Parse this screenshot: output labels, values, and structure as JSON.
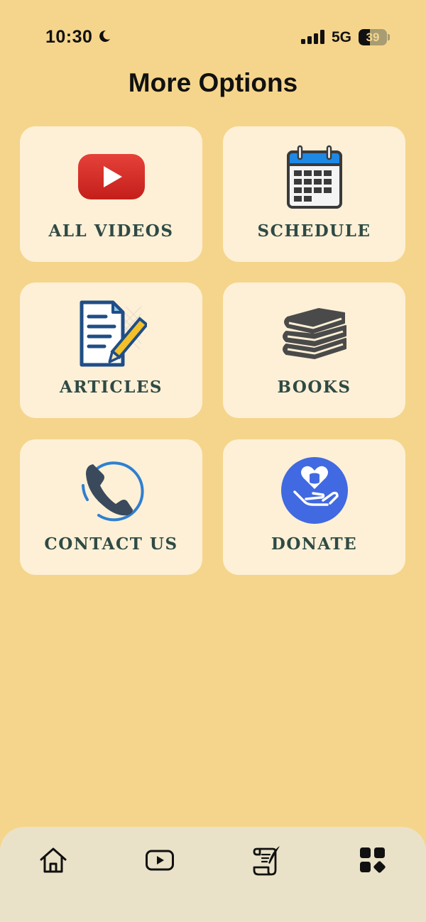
{
  "status_bar": {
    "time": "10:30",
    "network": "5G",
    "battery_level": "39",
    "battery_fraction": 0.39,
    "icons": [
      "moon-icon",
      "signal-icon",
      "battery-icon"
    ]
  },
  "page": {
    "title": "More Options"
  },
  "options": [
    {
      "label": "ALL VIDEOS",
      "icon": "youtube-play-icon"
    },
    {
      "label": "SCHEDULE",
      "icon": "calendar-icon"
    },
    {
      "label": "ARTICLES",
      "icon": "document-pencil-icon"
    },
    {
      "label": "BOOKS",
      "icon": "books-stack-icon"
    },
    {
      "label": "CONTACT US",
      "icon": "phone-icon"
    },
    {
      "label": "DONATE",
      "icon": "donate-hand-heart-icon"
    }
  ],
  "tab_bar": {
    "items": [
      {
        "icon": "home-icon"
      },
      {
        "icon": "video-play-icon"
      },
      {
        "icon": "scroll-quill-icon"
      },
      {
        "icon": "grid-more-icon",
        "selected": true
      }
    ]
  },
  "colors": {
    "background": "#F5D58C",
    "card": "#FDF0D6",
    "label": "#2F4A45",
    "tab_bar": "#EAE2C8",
    "youtube_red": "#D9312B",
    "calendar_blue": "#1E88E5",
    "donate_blue": "#4169E1"
  }
}
